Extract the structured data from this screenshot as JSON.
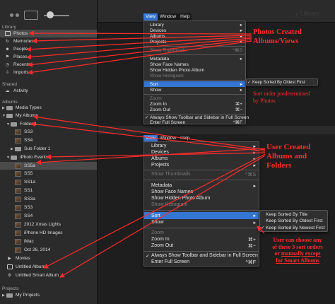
{
  "sidebar": {
    "library_header": "Library",
    "library": [
      "Photos",
      "Memories",
      "People",
      "Places",
      "Recents",
      "Imports"
    ],
    "shared_header": "Shared",
    "shared": [
      "Activity"
    ],
    "albums_header": "Albums",
    "albums": [
      "Media Types",
      "My Albums",
      "Folder 1",
      "SS3",
      "SS4",
      "Sub Folder 1",
      "iPhoto Events",
      "SS5a",
      "SS5",
      "SS1a",
      "SS1",
      "SS3a",
      "SS3",
      "SS4",
      "2012 Xmas Lights",
      "iPhone HD Images",
      "iMac",
      "Oct 26, 2014",
      "Movies",
      "Untitled Album",
      "Untitled Smart Album"
    ],
    "projects_header": "Projects",
    "projects": [
      "My Projects"
    ]
  },
  "window": {
    "title_partial": "y Library"
  },
  "menubar1": [
    "View",
    "Window",
    "Help"
  ],
  "menubar2": [
    "View",
    "Window",
    "Help"
  ],
  "menu1": {
    "items": [
      "Library",
      "Devices",
      "Albums",
      "Projects",
      "Show Thumbnails",
      "Metadata",
      "Show Face Names",
      "Show Hidden Photo Album",
      "Show Histogram",
      "Sort",
      "Show",
      "Zoom",
      "Zoom In",
      "Zoom Out",
      "Always Show Toolbar and Sidebar in Full Screen",
      "Enter Full Screen"
    ],
    "shortcuts": {
      "thumbs": "^⌘S",
      "zoomin": "⌘+",
      "zoomout": "⌘−",
      "fullscreen": "^⌘F"
    },
    "submenu": "Keep Sorted By Oldest First"
  },
  "menu2": {
    "items": [
      "Library",
      "Devices",
      "Albums",
      "Projects",
      "Show Thumbnails",
      "Metadata",
      "Show Face Names",
      "Show Hidden Photo Album",
      "Show Histogram",
      "Sort",
      "Show",
      "Zoom",
      "Zoom In",
      "Zoom Out",
      "Always Show Toolbar and Sidebar in Full Screen",
      "Enter Full Screen"
    ],
    "shortcuts": {
      "thumbs": "^⌘S",
      "zoomin": "⌘+",
      "zoomout": "⌘−",
      "fullscreen": "^⌘F"
    },
    "submenu": [
      "Keep Sorted By Title",
      "Keep Sorted By Oldest First",
      "Keep Sorted By Newest First"
    ]
  },
  "annotations": {
    "a1": [
      "Photos Created",
      "Albums/Views"
    ],
    "a2": [
      "Sort order predetermined",
      "by Photos"
    ],
    "a3": [
      "User Created",
      "Albums and",
      "Folders"
    ],
    "a4": [
      "User can choose any",
      "of these 3 sort orders"
    ],
    "a5_pre": "or ",
    "a5_u": "manually except",
    "a6": "for Smart Albums"
  },
  "colors": {
    "annotation": "#ff2b2b",
    "highlight": "#3476d3",
    "menu_bg": "#2f2f2f"
  }
}
